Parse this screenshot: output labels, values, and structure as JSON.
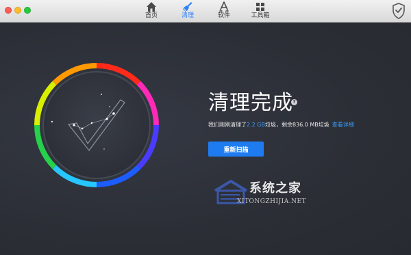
{
  "toolbar": {
    "tabs": [
      {
        "label": "首页",
        "icon": "home-icon",
        "active": false
      },
      {
        "label": "清理",
        "icon": "broom-icon",
        "active": true
      },
      {
        "label": "软件",
        "icon": "app-store-icon",
        "active": false
      },
      {
        "label": "工具箱",
        "icon": "grid-icon",
        "active": false
      }
    ],
    "shield_icon": "shield-check-icon"
  },
  "result": {
    "title": "清理完成",
    "summary_prefix": "我们刚刚清理了",
    "cleaned_amount": "2.2 GB",
    "summary_middle": "垃圾，剩余836.0 MB垃圾",
    "details_link": "查看详细",
    "rescan_button": "重新扫描"
  },
  "watermark": {
    "title": "系统之家",
    "url": "XITONGZHIJIA.NET"
  },
  "colors": {
    "accent": "#1f7cf0",
    "background": "#2d3038",
    "link": "#3aa0ff"
  }
}
